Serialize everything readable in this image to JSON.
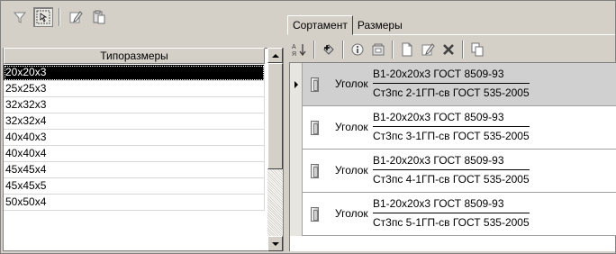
{
  "left_panel": {
    "column_header": "Типоразмеры",
    "sizes": [
      "20x20x3",
      "25x25x3",
      "32x32x3",
      "32x32x4",
      "40x40x3",
      "40x40x4",
      "45x45x4",
      "45x45x5",
      "50x50x4"
    ],
    "selected_index": 0
  },
  "left_toolbar": {
    "icons": [
      "filter-icon",
      "select-range-icon",
      "edit-icon",
      "paste-icon"
    ]
  },
  "right_panel": {
    "tabs": [
      {
        "label": "Сортамент",
        "active": true
      },
      {
        "label": "Размеры",
        "active": false
      }
    ],
    "toolbar_icons": [
      "sort-icon",
      "add-icon",
      "info-icon",
      "library-icon",
      "new-document-icon",
      "edit-icon",
      "delete-icon",
      "copy-icon"
    ],
    "rows": [
      {
        "name": "Уголок",
        "designation": "В1-20x20x3 ГОСТ 8509-93",
        "material": "Ст3пс 2-1ГП-св ГОСТ 535-2005",
        "current": true
      },
      {
        "name": "Уголок",
        "designation": "В1-20x20x3 ГОСТ 8509-93",
        "material": "Ст3пс 3-1ГП-св ГОСТ 535-2005",
        "current": false
      },
      {
        "name": "Уголок",
        "designation": "В1-20x20x3 ГОСТ 8509-93",
        "material": "Ст3пс 4-1ГП-св ГОСТ 535-2005",
        "current": false
      },
      {
        "name": "Уголок",
        "designation": "В1-20x20x3 ГОСТ 8509-93",
        "material": "Ст3пс 5-1ГП-св ГОСТ 535-2005",
        "current": false
      }
    ]
  },
  "colors": {
    "face": "#d4d0c8",
    "selection": "#000000",
    "current_row": "#d0d0d0"
  }
}
